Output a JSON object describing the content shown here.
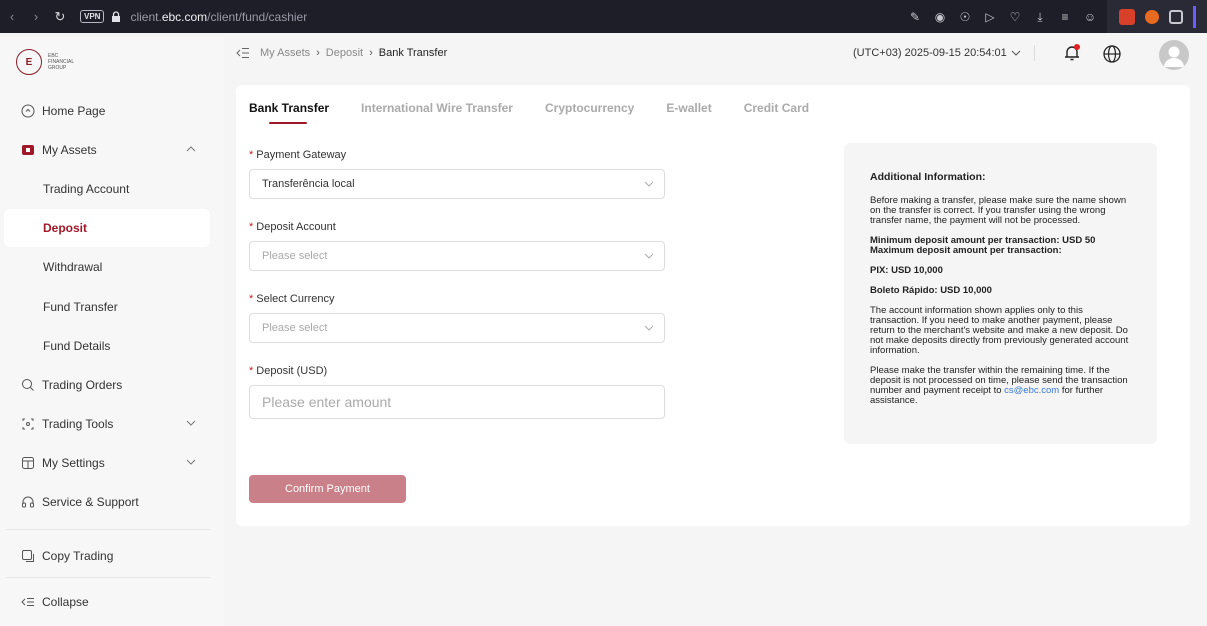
{
  "browser": {
    "url_prefix": "client.",
    "url_host": "ebc.com",
    "url_path": "/client/fund/cashier",
    "vpn_label": "VPN"
  },
  "sidebar": {
    "logo_lines": [
      "EBC",
      "FINANCIAL",
      "GROUP"
    ],
    "items": [
      {
        "label": "Home Page",
        "icon": "home-icon"
      },
      {
        "label": "My Assets",
        "icon": "assets-icon"
      },
      {
        "label": "Trading Account"
      },
      {
        "label": "Deposit"
      },
      {
        "label": "Withdrawal"
      },
      {
        "label": "Fund Transfer"
      },
      {
        "label": "Fund Details"
      },
      {
        "label": "Trading Orders",
        "icon": "orders-icon"
      },
      {
        "label": "Trading Tools",
        "icon": "tools-icon"
      },
      {
        "label": "My Settings",
        "icon": "settings-icon"
      },
      {
        "label": "Service & Support",
        "icon": "support-icon"
      },
      {
        "label": "Copy Trading",
        "icon": "copy-trading-icon"
      }
    ],
    "collapse_label": "Collapse"
  },
  "header": {
    "breadcrumb": [
      "My Assets",
      "Deposit",
      "Bank Transfer"
    ],
    "timezone": "(UTC+03) 2025-09-15 20:54:01"
  },
  "tabs": [
    {
      "label": "Bank Transfer",
      "active": true
    },
    {
      "label": "International Wire Transfer"
    },
    {
      "label": "Cryptocurrency"
    },
    {
      "label": "E-wallet"
    },
    {
      "label": "Credit Card"
    }
  ],
  "form": {
    "gateway_label": "Payment Gateway",
    "gateway_value": "Transferência local",
    "account_label": "Deposit Account",
    "account_placeholder": "Please select",
    "currency_label": "Select Currency",
    "currency_placeholder": "Please select",
    "amount_label": "Deposit (USD)",
    "amount_placeholder": "Please enter amount",
    "confirm_label": "Confirm Payment"
  },
  "info": {
    "title": "Additional Information:",
    "p1": "Before making a transfer, please make sure the name shown on the transfer is correct. If you transfer using the wrong transfer name, the payment will not be processed.",
    "min_line": "Minimum deposit amount per transaction: USD 50",
    "max_line": "Maximum deposit amount per transaction:",
    "pix": "PIX: USD 10,000",
    "boleto": "Boleto Rápido: USD 10,000",
    "p2": "The account information shown applies only to this transaction. If you need to make another payment, please return to the merchant's website and make a new deposit. Do not make deposits directly from previously generated account information.",
    "p3": "Please make the transfer within the remaining time. If the deposit is not processed on time, please send the transaction number and payment receipt to",
    "email": "cs@ebc.com",
    "p3_end": "for further assistance."
  },
  "colors": {
    "brand": "#a01828",
    "button": "#c98088",
    "link": "#3a7ad8"
  }
}
